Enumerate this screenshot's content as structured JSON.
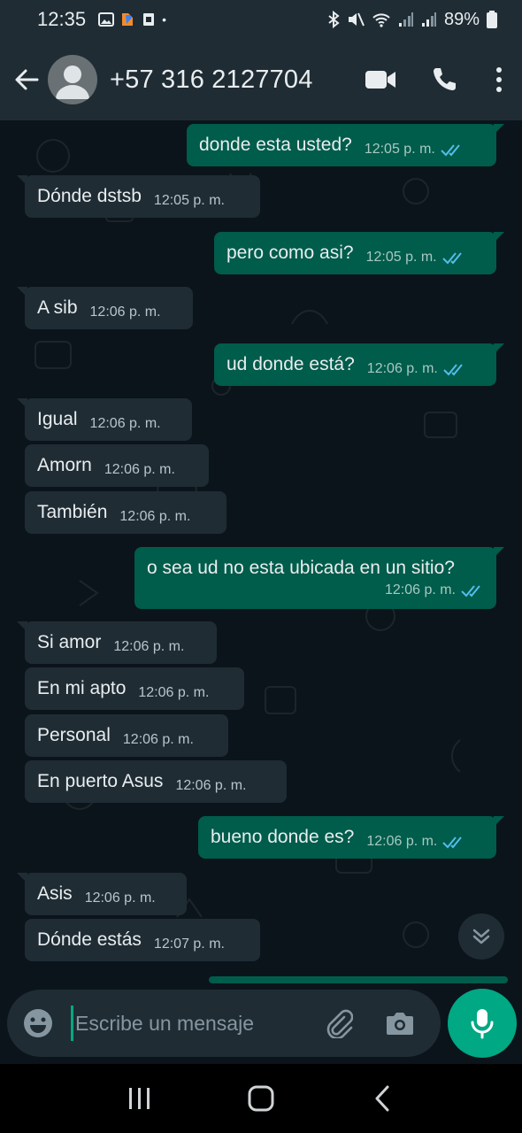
{
  "status_bar": {
    "time": "12:35",
    "battery": "89%",
    "dot": "•"
  },
  "header": {
    "contact_name": "+57 316 2127704"
  },
  "messages": [
    {
      "dir": "out",
      "text": "donde esta usted?",
      "time": "12:05 p. m.",
      "read": true
    },
    {
      "dir": "in",
      "text": "Dónde dstsb",
      "time": "12:05 p. m."
    },
    {
      "dir": "out",
      "text": "pero como asi?",
      "time": "12:05 p. m.",
      "read": true
    },
    {
      "dir": "in",
      "text": "A sib",
      "time": "12:06 p. m."
    },
    {
      "dir": "out",
      "text": "ud donde está?",
      "time": "12:06 p. m.",
      "read": true
    },
    {
      "dir": "in",
      "text": "Igual",
      "time": "12:06 p. m."
    },
    {
      "dir": "in",
      "text": "Amorn",
      "time": "12:06 p. m."
    },
    {
      "dir": "in",
      "text": "También",
      "time": "12:06 p. m."
    },
    {
      "dir": "out",
      "text": "o sea ud no esta ubicada en un sitio?",
      "time": "12:06 p. m.",
      "read": true
    },
    {
      "dir": "in",
      "text": "Si amor",
      "time": "12:06 p. m."
    },
    {
      "dir": "in",
      "text": "En mi apto",
      "time": "12:06 p. m."
    },
    {
      "dir": "in",
      "text": "Personal",
      "time": "12:06 p. m."
    },
    {
      "dir": "in",
      "text": "En puerto Asus",
      "time": "12:06 p. m."
    },
    {
      "dir": "out",
      "text": "bueno donde es?",
      "time": "12:06 p. m.",
      "read": true
    },
    {
      "dir": "in",
      "text": "Asis",
      "time": "12:06 p. m."
    },
    {
      "dir": "in",
      "text": "Dónde estás",
      "time": "12:07 p. m."
    }
  ],
  "composer": {
    "placeholder": "Escribe un mensaje"
  },
  "colors": {
    "incoming_bubble": "#1f2c34",
    "outgoing_bubble": "#005c4b",
    "accent": "#00a884",
    "read_tick": "#53bdeb"
  }
}
